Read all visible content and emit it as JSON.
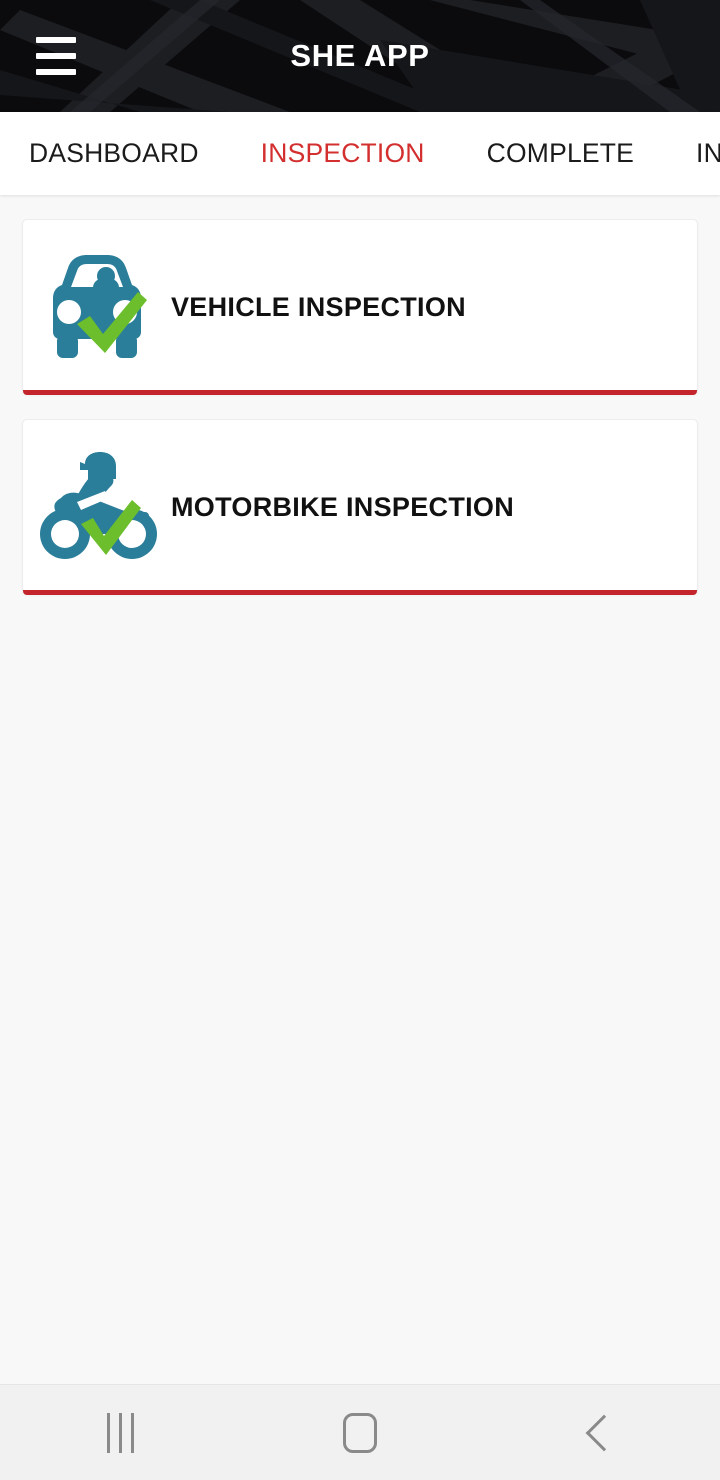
{
  "app": {
    "title": "SHE APP",
    "menu_icon": "hamburger-menu-icon"
  },
  "tabs": [
    {
      "label": "DASHBOARD",
      "active": false
    },
    {
      "label": "INSPECTION",
      "active": true
    },
    {
      "label": "COMPLETE",
      "active": false
    },
    {
      "label": "INCOMPLETE",
      "active": false
    }
  ],
  "cards": [
    {
      "label": "VEHICLE INSPECTION",
      "icon": "car-check-icon"
    },
    {
      "label": "MOTORBIKE INSPECTION",
      "icon": "motorbike-check-icon"
    }
  ],
  "navbar": {
    "recents_label": "recents-icon",
    "home_label": "home-icon",
    "back_label": "back-icon"
  },
  "colors": {
    "accent_red": "#c4242b",
    "active_tab_red": "#d32f2f",
    "icon_teal": "#2a7e99",
    "icon_green": "#6cbe2d",
    "appbar_bg": "#0b0b0d",
    "page_bg": "#f8f8f8",
    "card_bg": "#ffffff"
  }
}
